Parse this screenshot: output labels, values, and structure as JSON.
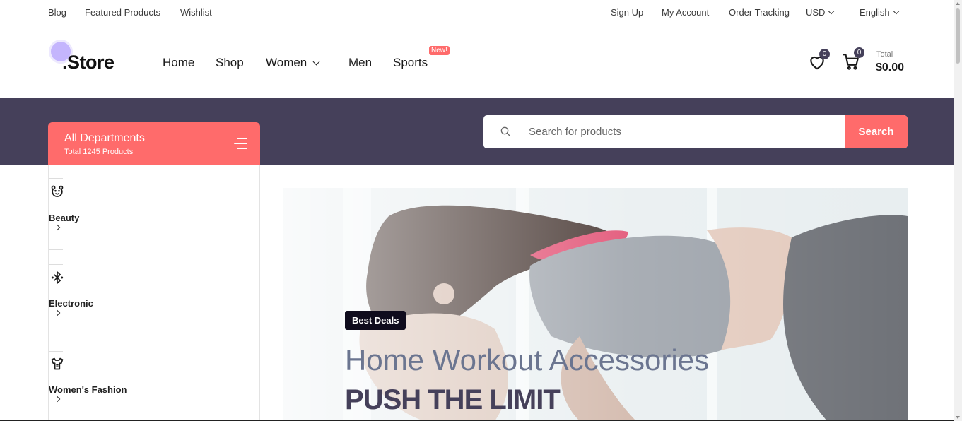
{
  "topbar": {
    "left": [
      "Blog",
      "Featured Products",
      "Wishlist"
    ],
    "sign_up": "Sign Up",
    "my_account": "My Account",
    "order_tracking": "Order Tracking",
    "currency": "USD",
    "language": "English"
  },
  "brand": {
    "name": ".Store"
  },
  "nav": {
    "home": "Home",
    "shop": "Shop",
    "women": "Women",
    "men": "Men",
    "sports": "Sports",
    "sports_badge": "New!"
  },
  "header": {
    "wishlist_count": "0",
    "cart_count": "0",
    "total_label": "Total",
    "total_value": "$0.00"
  },
  "departments": {
    "title": "All Departments",
    "subtitle": "Total 1245 Products"
  },
  "search": {
    "placeholder": "Search for products",
    "value": "",
    "button": "Search"
  },
  "categories": [
    {
      "label": "Beauty",
      "icon": "bear-icon"
    },
    {
      "label": "Electronic",
      "icon": "bluetooth-icon"
    },
    {
      "label": "Women's Fashion",
      "icon": "dress-icon"
    }
  ],
  "hero": {
    "badge": "Best Deals",
    "subtitle": "Home Workout Accessories",
    "title": "PUSH THE LIMIT"
  },
  "colors": {
    "accent": "#ff6b6b",
    "band": "#45405a",
    "badge_dark": "#0f0c1d"
  }
}
